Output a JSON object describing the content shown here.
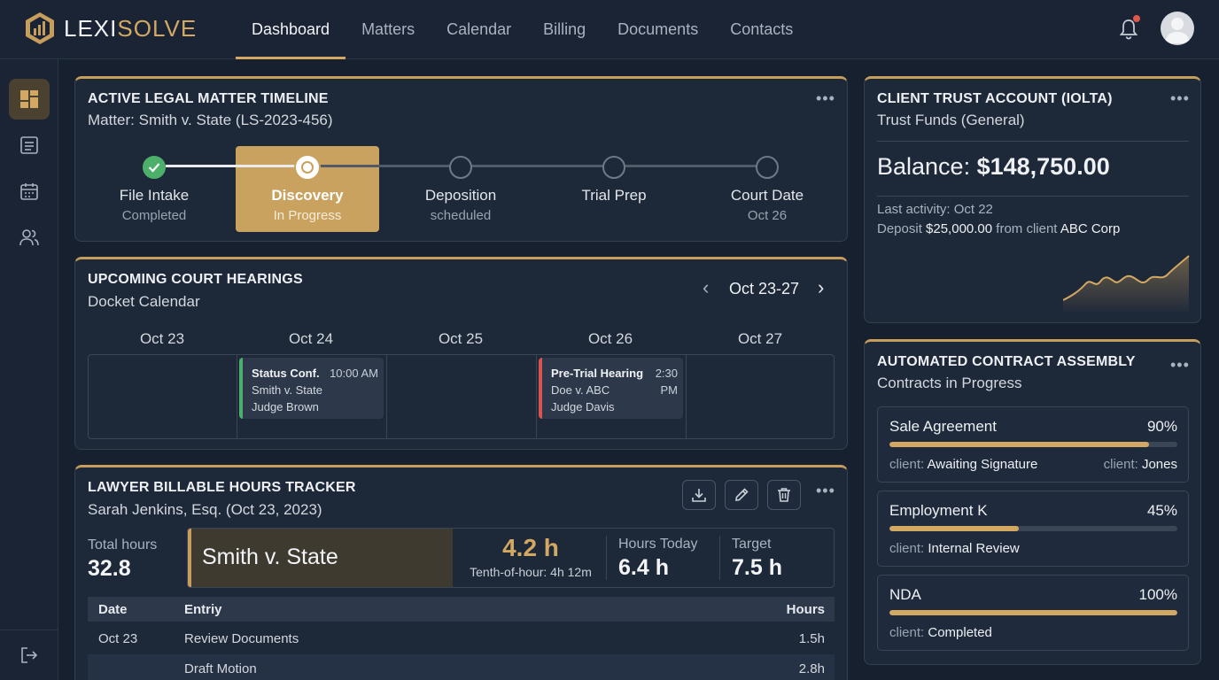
{
  "app": {
    "brand_part1": "LEXI",
    "brand_part2": "SOLVE",
    "nav": [
      "Dashboard",
      "Matters",
      "Calendar",
      "Billing",
      "Documents",
      "Contacts"
    ]
  },
  "timeline": {
    "title": "ACTIVE LEGAL MATTER TIMELINE",
    "subtitle": "Matter: Smith v. State (LS-2023-456)",
    "menu": "•••",
    "steps": [
      {
        "label": "File Intake",
        "status": "Completed"
      },
      {
        "label": "Discovery",
        "status": "In Progress"
      },
      {
        "label": "Deposition",
        "status": "scheduled"
      },
      {
        "label": "Trial Prep",
        "status": ""
      },
      {
        "label": "Court Date",
        "status": "Oct 26"
      }
    ]
  },
  "hearings": {
    "title": "UPCOMING COURT HEARINGS",
    "subtitle": "Docket Calendar",
    "range": "Oct 23-27",
    "prev_icon": "‹",
    "next_icon": "›",
    "days": [
      "Oct 23",
      "Oct 24",
      "Oct 25",
      "Oct 26",
      "Oct 27"
    ],
    "events": [
      {
        "title": "Status Conf.",
        "time": "10:00 AM",
        "case": "Smith v. State",
        "judge": "Judge Brown",
        "color": "#4caf6a"
      },
      {
        "title": "Pre-Trial Hearing",
        "time_a": "2:30",
        "time_b": "PM",
        "case": "Doe v. ABC",
        "judge": "Judge Davis",
        "color": "#d9534f"
      }
    ]
  },
  "billing": {
    "title": "LAWYER BILLABLE HOURS TRACKER",
    "subtitle": "Sarah Jenkins, Esq. (Oct 23, 2023)",
    "total_label": "Total hours",
    "total_value": "32.8",
    "matter": "Smith v. State",
    "current": "4.2 h",
    "current_note": "Tenth-of-hour: 4h 12m",
    "today_label": "Hours Today",
    "today_value": "6.4 h",
    "target_label": "Target",
    "target_value": "7.5 h",
    "columns": [
      "Date",
      "Entriy",
      "Hours"
    ],
    "rows": [
      {
        "date": "Oct 23",
        "entry": "Review Documents",
        "hours": "1.5h"
      },
      {
        "date": "",
        "entry": "Draft Motion",
        "hours": "2.8h"
      }
    ]
  },
  "trust": {
    "title": "CLIENT TRUST ACCOUNT (IOLTA)",
    "subtitle": "Trust Funds (General)",
    "balance_label": "Balance: ",
    "balance_value": "$148,750.00",
    "last_activity": "Last activity: Oct 22",
    "deposit_pre": "Deposit ",
    "deposit_amount": "$25,000.00",
    "deposit_mid": " from client ",
    "deposit_client": "ABC Corp"
  },
  "contracts": {
    "title": "AUTOMATED CONTRACT ASSEMBLY",
    "subtitle": "Contracts in Progress",
    "items": [
      {
        "name": "Sale Agreement",
        "pct": "90%",
        "progress": 0.9,
        "meta_key": "client:",
        "meta_val": "Awaiting Signature",
        "meta2_key": "client:",
        "meta2_val": "Jones"
      },
      {
        "name": "Employment K",
        "pct": "45%",
        "progress": 0.45,
        "meta_key": "client:",
        "meta_val": "Internal Review"
      },
      {
        "name": "NDA",
        "pct": "100%",
        "progress": 1.0,
        "meta_key": "client:",
        "meta_val": "Completed"
      }
    ]
  },
  "colors": {
    "accent": "#d2a862",
    "bg": "#16202f",
    "card": "#1d2839"
  }
}
